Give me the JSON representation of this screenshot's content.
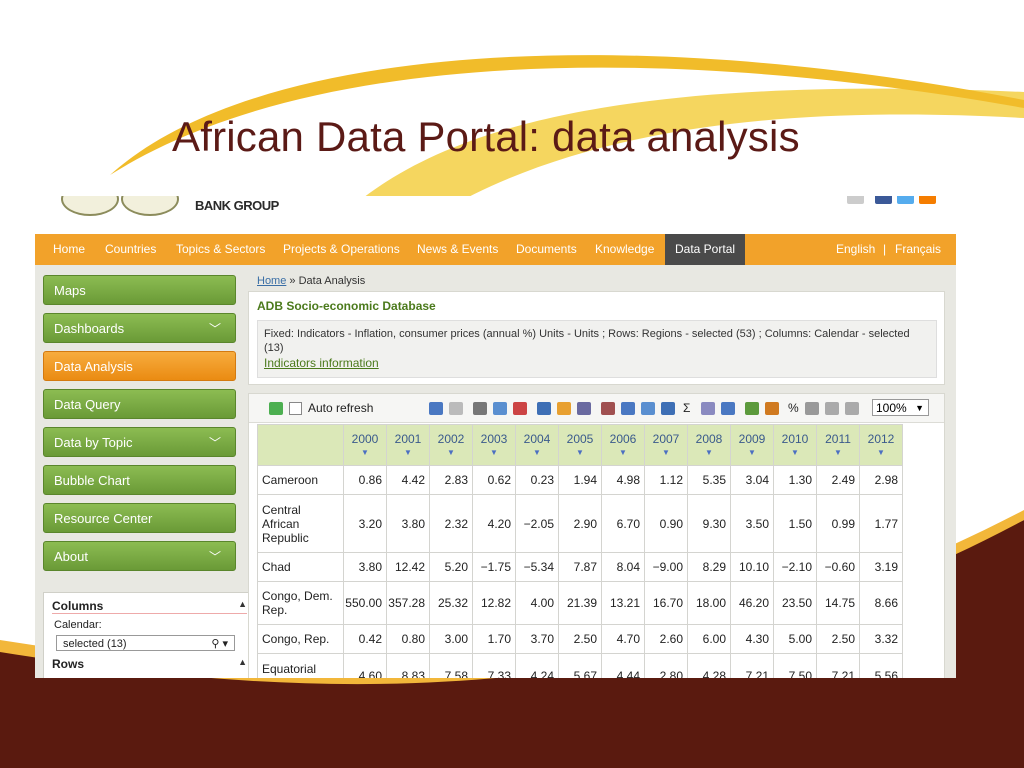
{
  "slide_title": "African Data Portal: data analysis",
  "site": {
    "bank_group_label": "BANK GROUP",
    "nav_items": [
      "Home",
      "Countries",
      "Topics & Sectors",
      "Projects & Operations",
      "News & Events",
      "Documents",
      "Knowledge",
      "Data Portal"
    ],
    "active_nav": "Data Portal",
    "lang_english": "English",
    "lang_sep": "|",
    "lang_french": "Français"
  },
  "sidebar": {
    "items": [
      {
        "label": "Maps",
        "has_dropdown": false
      },
      {
        "label": "Dashboards",
        "has_dropdown": true
      },
      {
        "label": "Data Analysis",
        "has_dropdown": false,
        "active": true
      },
      {
        "label": "Data Query",
        "has_dropdown": false
      },
      {
        "label": "Data by Topic",
        "has_dropdown": true
      },
      {
        "label": "Bubble Chart",
        "has_dropdown": false
      },
      {
        "label": "Resource Center",
        "has_dropdown": false
      },
      {
        "label": "About",
        "has_dropdown": true
      }
    ],
    "chevron": "﹀",
    "panel": {
      "columns_header": "Columns",
      "calendar_label": "Calendar:",
      "calendar_value": "selected (13)",
      "rows_header": "Rows"
    }
  },
  "breadcrumb": {
    "home": "Home",
    "sep": "»",
    "current": "Data Analysis"
  },
  "info": {
    "title": "ADB Socio-economic Database",
    "fixed_text": "Fixed: Indicators - Inflation, consumer prices (annual %) Units - Units ; Rows: Regions - selected (53) ; Columns: Calendar - selected (13)",
    "link_text": "Indicators information"
  },
  "toolbar": {
    "auto_refresh_label": "Auto refresh",
    "zoom_value": "100%",
    "sigma": "Σ",
    "percent": "%"
  },
  "colors": {
    "nav_orange": "#f2a22a",
    "green_button": "#7aab44",
    "active_orange": "#f19a22",
    "header_green": "#dbe8b8",
    "title_maroon": "#5b1a16"
  },
  "table": {
    "years": [
      "2000",
      "2001",
      "2002",
      "2003",
      "2004",
      "2005",
      "2006",
      "2007",
      "2008",
      "2009",
      "2010",
      "2011",
      "2012"
    ],
    "sort_marker": "▼",
    "rows": [
      {
        "name": "Cameroon",
        "values": [
          "0.86",
          "4.42",
          "2.83",
          "0.62",
          "0.23",
          "1.94",
          "4.98",
          "1.12",
          "5.35",
          "3.04",
          "1.30",
          "2.49",
          "2.98"
        ]
      },
      {
        "name": "Central African Republic",
        "values": [
          "3.20",
          "3.80",
          "2.32",
          "4.20",
          "−2.05",
          "2.90",
          "6.70",
          "0.90",
          "9.30",
          "3.50",
          "1.50",
          "0.99",
          "1.77"
        ]
      },
      {
        "name": "Chad",
        "values": [
          "3.80",
          "12.42",
          "5.20",
          "−1.75",
          "−5.34",
          "7.87",
          "8.04",
          "−9.00",
          "8.29",
          "10.10",
          "−2.10",
          "−0.60",
          "3.19"
        ]
      },
      {
        "name": "Congo, Dem. Rep.",
        "values": [
          "550.00",
          "357.28",
          "25.32",
          "12.82",
          "4.00",
          "21.39",
          "13.21",
          "16.70",
          "18.00",
          "46.20",
          "23.50",
          "14.75",
          "8.66"
        ]
      },
      {
        "name": "Congo, Rep.",
        "values": [
          "0.42",
          "0.80",
          "3.00",
          "1.70",
          "3.70",
          "2.50",
          "4.70",
          "2.60",
          "6.00",
          "4.30",
          "5.00",
          "2.50",
          "3.32"
        ]
      },
      {
        "name": "Equatorial",
        "values": [
          "4.60",
          "8.83",
          "7.58",
          "7.33",
          "4.24",
          "5.67",
          "4.44",
          "2.80",
          "4.28",
          "7.21",
          "7.50",
          "7.21",
          "5.56"
        ]
      }
    ]
  }
}
